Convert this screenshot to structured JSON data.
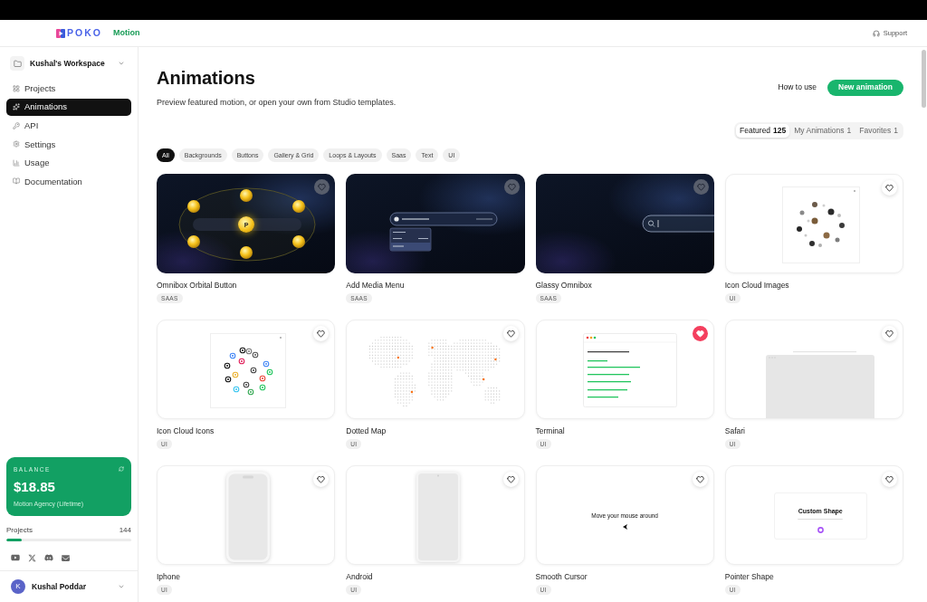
{
  "header": {
    "brand": "POKO",
    "product": "Motion",
    "support": "Support"
  },
  "sidebar": {
    "workspace": "Kushal's Workspace",
    "nav": [
      {
        "label": "Projects",
        "selected": false
      },
      {
        "label": "Animations",
        "selected": true
      },
      {
        "label": "API",
        "selected": false
      },
      {
        "label": "Settings",
        "selected": false
      },
      {
        "label": "Usage",
        "selected": false
      },
      {
        "label": "Documentation",
        "selected": false
      }
    ],
    "balance": {
      "label": "BALANCE",
      "amount": "$18.85",
      "plan": "Motion Agency (Lifetime)"
    },
    "usage": {
      "label": "Projects",
      "count": "144",
      "level": 0.12
    },
    "user": {
      "initial": "K",
      "name": "Kushal Poddar"
    }
  },
  "page": {
    "title": "Animations",
    "subtitle": "Preview featured motion, or open your own from Studio templates.",
    "help_link": "How to use",
    "primary_button": "New animation"
  },
  "tabs": [
    {
      "label": "Featured",
      "count": "125",
      "selected": true
    },
    {
      "label": "My Animations",
      "count": "1",
      "selected": false
    },
    {
      "label": "Favorites",
      "count": "1",
      "selected": false
    }
  ],
  "filters": [
    {
      "label": "All",
      "selected": true
    },
    {
      "label": "Backgrounds",
      "selected": false
    },
    {
      "label": "Buttons",
      "selected": false
    },
    {
      "label": "Gallery & Grid",
      "selected": false
    },
    {
      "label": "Loops & Layouts",
      "selected": false
    },
    {
      "label": "Saas",
      "selected": false
    },
    {
      "label": "Text",
      "selected": false
    },
    {
      "label": "UI",
      "selected": false
    }
  ],
  "cards": [
    {
      "title": "Omnibox Orbital Button",
      "tag": "SAAS",
      "favorite": false,
      "kind": "orbit",
      "preview_text": "P"
    },
    {
      "title": "Add Media Menu",
      "tag": "SAAS",
      "favorite": false,
      "kind": "media-menu"
    },
    {
      "title": "Glassy Omnibox",
      "tag": "SAAS",
      "favorite": false,
      "kind": "omnibox"
    },
    {
      "title": "Icon Cloud Images",
      "tag": "UI",
      "favorite": false,
      "kind": "image-cloud"
    },
    {
      "title": "Icon Cloud Icons",
      "tag": "UI",
      "favorite": false,
      "kind": "icon-cloud"
    },
    {
      "title": "Dotted Map",
      "tag": "UI",
      "favorite": false,
      "kind": "dot-map"
    },
    {
      "title": "Terminal",
      "tag": "UI",
      "favorite": true,
      "kind": "terminal"
    },
    {
      "title": "Safari",
      "tag": "UI",
      "favorite": false,
      "kind": "browser"
    },
    {
      "title": "Iphone",
      "tag": "UI",
      "favorite": false,
      "kind": "iphone"
    },
    {
      "title": "Android",
      "tag": "UI",
      "favorite": false,
      "kind": "android"
    },
    {
      "title": "Smooth Cursor",
      "tag": "UI",
      "favorite": false,
      "kind": "cursor",
      "preview_text": "Move your mouse around"
    },
    {
      "title": "Pointer Shape",
      "tag": "UI",
      "favorite": false,
      "kind": "pointer",
      "preview_text": "Custom Shape"
    }
  ]
}
